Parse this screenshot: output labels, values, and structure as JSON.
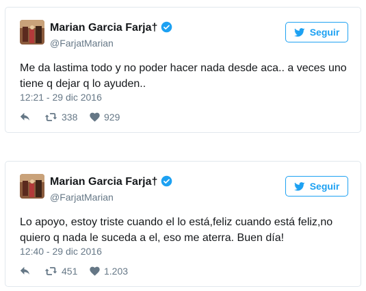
{
  "tweets": [
    {
      "author_name": "Marian Garcia Farja†",
      "handle": "@FarjatMarian",
      "follow_label": "Seguir",
      "text": "Me da lastima todo y no poder hacer nada desde aca.. a veces uno tiene q dejar q lo ayuden..",
      "timestamp": "12:21 - 29 dic 2016",
      "retweets": "338",
      "likes": "929"
    },
    {
      "author_name": "Marian Garcia Farja†",
      "handle": "@FarjatMarian",
      "follow_label": "Seguir",
      "text": "Lo apoyo, estoy triste cuando el lo está,feliz cuando está feliz,no quiero q nada le suceda a el, eso me aterra. Buen día!",
      "timestamp": "12:40 - 29 dic 2016",
      "retweets": "451",
      "likes": "1.203"
    }
  ],
  "colors": {
    "accent": "#1da1f2",
    "text": "#14171a",
    "muted": "#657786",
    "border": "#e1e8ed"
  },
  "icons": [
    "verified-badge-icon",
    "twitter-bird-icon",
    "reply-icon",
    "retweet-icon",
    "heart-icon"
  ]
}
